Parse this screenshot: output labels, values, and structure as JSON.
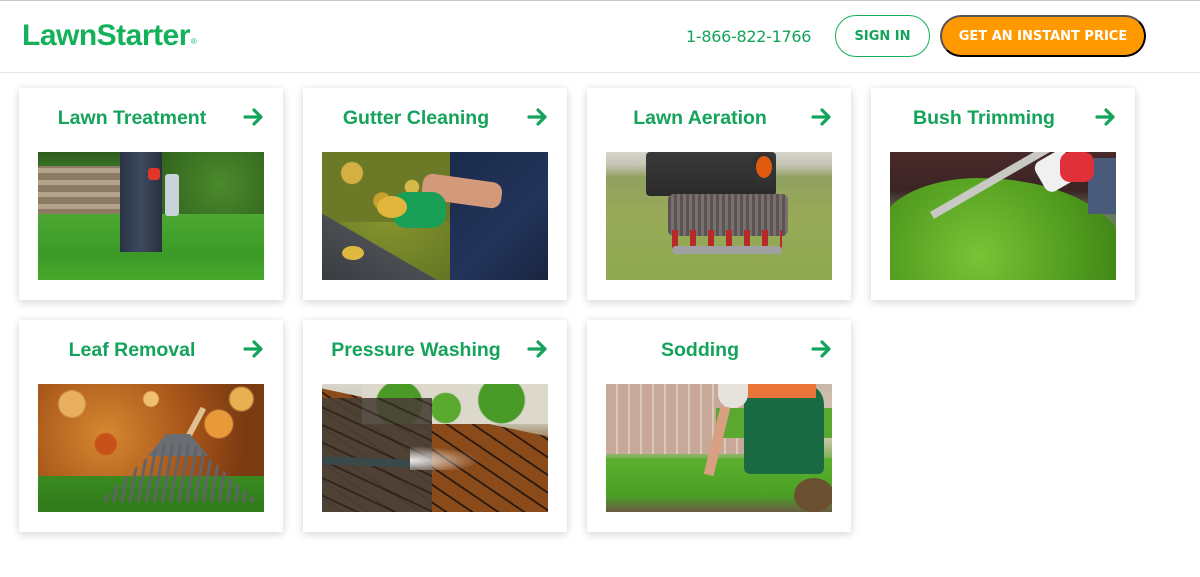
{
  "header": {
    "logo_text": "LawnStarter",
    "logo_mark": "®",
    "phone": "1-866-822-1766",
    "sign_in_label": "SIGN IN",
    "cta_label": "GET AN INSTANT PRICE"
  },
  "colors": {
    "brand_green": "#14b15b",
    "title_green": "#14a35a",
    "cta_orange": "#ff9900"
  },
  "services": [
    {
      "title": "Lawn Treatment",
      "icon": "arrow-right-icon",
      "image": "lawn-treatment-photo"
    },
    {
      "title": "Gutter Cleaning",
      "icon": "arrow-right-icon",
      "image": "gutter-cleaning-photo"
    },
    {
      "title": "Lawn Aeration",
      "icon": "arrow-right-icon",
      "image": "lawn-aeration-photo"
    },
    {
      "title": "Bush Trimming",
      "icon": "arrow-right-icon",
      "image": "bush-trimming-photo"
    },
    {
      "title": "Leaf Removal",
      "icon": "arrow-right-icon",
      "image": "leaf-removal-photo"
    },
    {
      "title": "Pressure Washing",
      "icon": "arrow-right-icon",
      "image": "pressure-washing-photo"
    },
    {
      "title": "Sodding",
      "icon": "arrow-right-icon",
      "image": "sodding-photo"
    }
  ]
}
